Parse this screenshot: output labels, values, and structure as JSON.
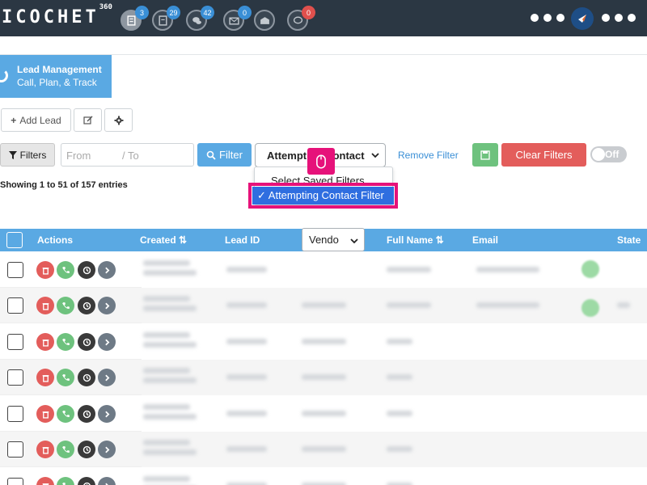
{
  "nav": {
    "brand": "ICOCHET",
    "brand_sup": "360",
    "icons": [
      {
        "name": "leads-nav-icon",
        "badge": "3",
        "badge_color": "#3a8fd6"
      },
      {
        "name": "documents-nav-icon",
        "badge": "29",
        "badge_color": "#3a8fd6"
      },
      {
        "name": "chat-nav-icon",
        "badge": "42",
        "badge_color": "#3a8fd6"
      },
      {
        "name": "mail-nav-icon",
        "badge": "0",
        "badge_color": "#3a8fd6"
      },
      {
        "name": "inbox-nav-icon",
        "badge": "",
        "badge_color": ""
      },
      {
        "name": "comments-nav-icon",
        "badge": "0",
        "badge_color": "#e0504d"
      }
    ]
  },
  "module": {
    "title": "Lead Management",
    "subtitle": "Call, Plan, & Track"
  },
  "toolbar": {
    "add_lead_label": "Add Lead",
    "filters_label": "Filters",
    "from_placeholder": "From",
    "to_placeholder": "/ To",
    "filter_label": "Filter",
    "saved_filter_value": "Attempting Contact",
    "remove_filter_label": "Remove Filter",
    "clear_filters_label": "Clear Filters",
    "toggle_label": "Off"
  },
  "dropdown": {
    "header": "Select Saved Filters",
    "selected": "✓ Attempting Contact Filter"
  },
  "showing_text": "Showing 1 to 51 of 157 entries",
  "table": {
    "columns": {
      "actions": "Actions",
      "created": "Created ⇅",
      "lead_id": "Lead ID",
      "vendor": "Vendo",
      "full_name": "Full Name ⇅",
      "email": "Email",
      "state": "State"
    }
  },
  "colors": {
    "topbar": "#2b3743",
    "accent": "#5aa9e3",
    "delete": "#e35d5b",
    "call": "#6ec27e",
    "highlight": "#e6127a"
  }
}
